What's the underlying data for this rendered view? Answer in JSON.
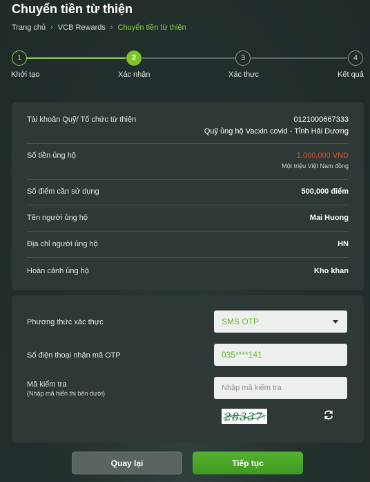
{
  "page_title": "Chuyển tiền từ thiện",
  "breadcrumb": {
    "home": "Trang chủ",
    "section": "VCB Rewards",
    "current": "Chuyển tiền từ thiện",
    "separator": "›"
  },
  "stepper": {
    "steps": [
      {
        "number": "1",
        "label": "Khởi tạo",
        "state": "done"
      },
      {
        "number": "2",
        "label": "Xác nhận",
        "state": "current"
      },
      {
        "number": "3",
        "label": "Xác thực",
        "state": "todo"
      },
      {
        "number": "4",
        "label": "Kết quả",
        "state": "todo"
      }
    ]
  },
  "info": {
    "account_label": "Tài khoản Quỹ/ Tổ chức từ thiện",
    "account_number": "0121000667333",
    "account_name": "Quỹ ủng hộ Vacxin covid - Tỉnh Hải Dương",
    "amount_label": "Số tiền ủng hộ",
    "amount_value": "1,000,000 VND",
    "amount_words": "Một triệu Việt Nam đồng",
    "points_label": "Số điểm cần sử dụng",
    "points_value": "500,000 điểm",
    "donor_label": "Tên người ủng hộ",
    "donor_value": "Mai Huong",
    "address_label": "Địa chỉ người ủng hộ",
    "address_value": "HN",
    "situation_label": "Hoàn cảnh ủng hộ",
    "situation_value": "Kho khan"
  },
  "auth": {
    "method_label": "Phương thức xác thực",
    "method_value": "SMS OTP",
    "phone_label": "Số điện thoại nhận mã OTP",
    "phone_value": "035****141",
    "captcha_label": "Mã kiểm tra",
    "captcha_hint": "(Nhập mã hiển thị bên dưới)",
    "captcha_placeholder": "Nhập mã kiểm tra",
    "captcha_image_text": "28337"
  },
  "buttons": {
    "back": "Quay lại",
    "next": "Tiếp tục"
  },
  "colors": {
    "accent_green": "#8fd14f",
    "amount_orange": "#e2572b",
    "next_button": "#4aa828"
  }
}
